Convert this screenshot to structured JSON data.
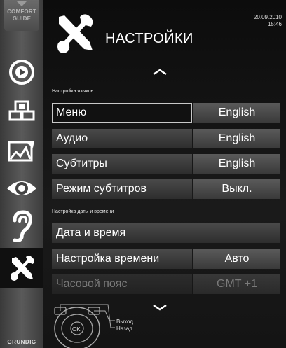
{
  "sidebar": {
    "guide_line1": "COMFORT",
    "guide_line2": "GUIDE",
    "items": [
      {
        "icon": "source-icon"
      },
      {
        "icon": "picture-icon"
      },
      {
        "icon": "photo-icon"
      },
      {
        "icon": "eye-icon"
      },
      {
        "icon": "ear-icon"
      },
      {
        "icon": "tools-icon",
        "active": true
      }
    ],
    "brand": "GRUNDIG"
  },
  "header": {
    "title": "НАСТРОЙКИ",
    "date": "20.09.2010",
    "time": "15:46"
  },
  "sections": {
    "language": "Настройка языков",
    "datetime": "Настройка даты и времени"
  },
  "rows": {
    "menu": {
      "label": "Меню",
      "value": "English"
    },
    "audio": {
      "label": "Аудио",
      "value": "English"
    },
    "subtitles": {
      "label": "Субтитры",
      "value": "English"
    },
    "subtitle_mode": {
      "label": "Режим субтитров",
      "value": "Выкл."
    },
    "date_time": {
      "label": "Дата и время"
    },
    "time_setting": {
      "label": "Настройка времени",
      "value": "Авто"
    },
    "timezone": {
      "label": "Часовой пояс",
      "value": "GMT +1"
    }
  },
  "legend": {
    "ok": "OK",
    "exit": "Выход",
    "back": "Назад"
  },
  "colors": {
    "text": "#ffffff",
    "disabled_text": "#7a7a7a",
    "selection_border": "#c8c8c8"
  }
}
